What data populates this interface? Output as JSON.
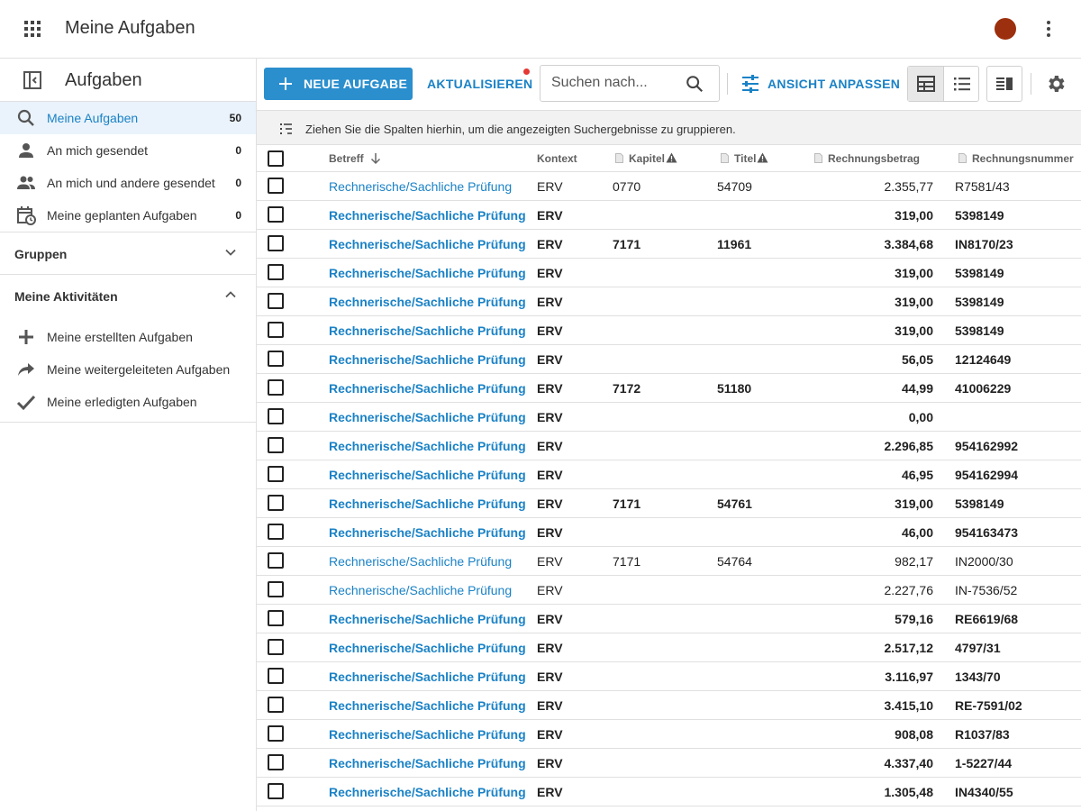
{
  "app": {
    "title": "Meine Aufgaben",
    "icons": {
      "apps": "apps-grid-icon",
      "more": "more-vert-icon"
    },
    "avatar_color": "#9c2f0d"
  },
  "sidebar": {
    "title": "Aufgaben",
    "items": [
      {
        "label": "Meine Aufgaben",
        "count": "50",
        "icon": "search-icon",
        "active": true
      },
      {
        "label": "An mich gesendet",
        "count": "0",
        "icon": "person-icon"
      },
      {
        "label": "An mich und andere gesendet",
        "count": "0",
        "icon": "people-icon"
      },
      {
        "label": "Meine geplanten Aufgaben",
        "count": "0",
        "icon": "calendar-clock-icon"
      }
    ],
    "groups_label": "Gruppen",
    "activities_label": "Meine Aktivitäten",
    "activities": [
      {
        "label": "Meine erstellten Aufgaben",
        "icon": "plus-icon"
      },
      {
        "label": "Meine weitergeleiteten Aufgaben",
        "icon": "forward-icon"
      },
      {
        "label": "Meine erledigten Aufgaben",
        "icon": "check-icon"
      }
    ]
  },
  "toolbar": {
    "new_task": "NEUE AUFGABE",
    "refresh": "AKTUALISIEREN",
    "search_placeholder": "Suchen nach...",
    "customize_view": "ANSICHT ANPASSEN"
  },
  "group_hint": "Ziehen Sie die Spalten hierhin, um die angezeigten Suchergebnisse zu gruppieren.",
  "columns": {
    "betreff": "Betreff",
    "kontext": "Kontext",
    "kapitel": "Kapitel",
    "titel": "Titel",
    "rechnungsbetrag": "Rechnungsbetrag",
    "rechnungsnummer": "Rechnungsnummer"
  },
  "colors": {
    "accent": "#2b8fce",
    "link": "#1a82c6",
    "alert_dot": "#e53935"
  },
  "rows": [
    {
      "betreff": "Rechnerische/Sachliche Prüfung",
      "kontext": "ERV",
      "kapitel": "0770",
      "titel": "54709",
      "betrag": "2.355,77",
      "nummer": "R7581/43",
      "bold": false
    },
    {
      "betreff": "Rechnerische/Sachliche Prüfung",
      "kontext": "ERV",
      "kapitel": "",
      "titel": "",
      "betrag": "319,00",
      "nummer": "5398149",
      "bold": true
    },
    {
      "betreff": "Rechnerische/Sachliche Prüfung",
      "kontext": "ERV",
      "kapitel": "7171",
      "titel": "11961",
      "betrag": "3.384,68",
      "nummer": "IN8170/23",
      "bold": true
    },
    {
      "betreff": "Rechnerische/Sachliche Prüfung",
      "kontext": "ERV",
      "kapitel": "",
      "titel": "",
      "betrag": "319,00",
      "nummer": "5398149",
      "bold": true
    },
    {
      "betreff": "Rechnerische/Sachliche Prüfung",
      "kontext": "ERV",
      "kapitel": "",
      "titel": "",
      "betrag": "319,00",
      "nummer": "5398149",
      "bold": true
    },
    {
      "betreff": "Rechnerische/Sachliche Prüfung",
      "kontext": "ERV",
      "kapitel": "",
      "titel": "",
      "betrag": "319,00",
      "nummer": "5398149",
      "bold": true
    },
    {
      "betreff": "Rechnerische/Sachliche Prüfung",
      "kontext": "ERV",
      "kapitel": "",
      "titel": "",
      "betrag": "56,05",
      "nummer": "12124649",
      "bold": true
    },
    {
      "betreff": "Rechnerische/Sachliche Prüfung",
      "kontext": "ERV",
      "kapitel": "7172",
      "titel": "51180",
      "betrag": "44,99",
      "nummer": "41006229",
      "bold": true
    },
    {
      "betreff": "Rechnerische/Sachliche Prüfung",
      "kontext": "ERV",
      "kapitel": "",
      "titel": "",
      "betrag": "0,00",
      "nummer": "",
      "bold": true
    },
    {
      "betreff": "Rechnerische/Sachliche Prüfung",
      "kontext": "ERV",
      "kapitel": "",
      "titel": "",
      "betrag": "2.296,85",
      "nummer": "954162992",
      "bold": true
    },
    {
      "betreff": "Rechnerische/Sachliche Prüfung",
      "kontext": "ERV",
      "kapitel": "",
      "titel": "",
      "betrag": "46,95",
      "nummer": "954162994",
      "bold": true
    },
    {
      "betreff": "Rechnerische/Sachliche Prüfung",
      "kontext": "ERV",
      "kapitel": "7171",
      "titel": "54761",
      "betrag": "319,00",
      "nummer": "5398149",
      "bold": true
    },
    {
      "betreff": "Rechnerische/Sachliche Prüfung",
      "kontext": "ERV",
      "kapitel": "",
      "titel": "",
      "betrag": "46,00",
      "nummer": "954163473",
      "bold": true
    },
    {
      "betreff": "Rechnerische/Sachliche Prüfung",
      "kontext": "ERV",
      "kapitel": "7171",
      "titel": "54764",
      "betrag": "982,17",
      "nummer": "IN2000/30",
      "bold": false
    },
    {
      "betreff": "Rechnerische/Sachliche Prüfung",
      "kontext": "ERV",
      "kapitel": "",
      "titel": "",
      "betrag": "2.227,76",
      "nummer": "IN-7536/52",
      "bold": false
    },
    {
      "betreff": "Rechnerische/Sachliche Prüfung",
      "kontext": "ERV",
      "kapitel": "",
      "titel": "",
      "betrag": "579,16",
      "nummer": "RE6619/68",
      "bold": true
    },
    {
      "betreff": "Rechnerische/Sachliche Prüfung",
      "kontext": "ERV",
      "kapitel": "",
      "titel": "",
      "betrag": "2.517,12",
      "nummer": "4797/31",
      "bold": true
    },
    {
      "betreff": "Rechnerische/Sachliche Prüfung",
      "kontext": "ERV",
      "kapitel": "",
      "titel": "",
      "betrag": "3.116,97",
      "nummer": "1343/70",
      "bold": true
    },
    {
      "betreff": "Rechnerische/Sachliche Prüfung",
      "kontext": "ERV",
      "kapitel": "",
      "titel": "",
      "betrag": "3.415,10",
      "nummer": "RE-7591/02",
      "bold": true
    },
    {
      "betreff": "Rechnerische/Sachliche Prüfung",
      "kontext": "ERV",
      "kapitel": "",
      "titel": "",
      "betrag": "908,08",
      "nummer": "R1037/83",
      "bold": true
    },
    {
      "betreff": "Rechnerische/Sachliche Prüfung",
      "kontext": "ERV",
      "kapitel": "",
      "titel": "",
      "betrag": "4.337,40",
      "nummer": "1-5227/44",
      "bold": true
    },
    {
      "betreff": "Rechnerische/Sachliche Prüfung",
      "kontext": "ERV",
      "kapitel": "",
      "titel": "",
      "betrag": "1.305,48",
      "nummer": "IN4340/55",
      "bold": true
    }
  ]
}
